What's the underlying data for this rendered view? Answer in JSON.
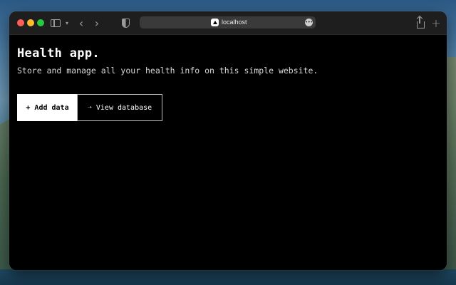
{
  "browser": {
    "url": "localhost",
    "icons": [
      "sidebar-icon",
      "chevron-down-icon",
      "back-arrow-icon",
      "forward-arrow-icon",
      "shield-icon",
      "site-icon",
      "more-icon",
      "share-icon",
      "plus-icon"
    ]
  },
  "page": {
    "title": "Health app.",
    "subtitle": "Store and manage all your health info on this simple website.",
    "buttons": {
      "add_label": "+ Add data",
      "view_label": "➝ View database"
    }
  },
  "colors": {
    "page_background": "#000000",
    "primary_button_bg": "#ffffff",
    "primary_button_text": "#000000",
    "secondary_button_border": "#bfbfbf"
  }
}
